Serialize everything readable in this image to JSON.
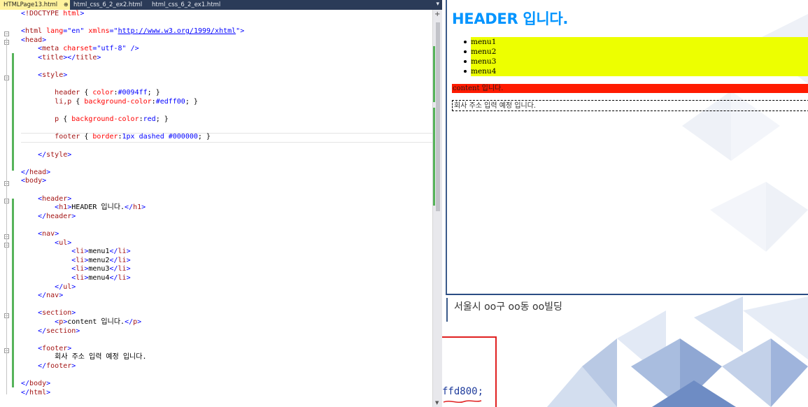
{
  "editor": {
    "tabs": [
      {
        "label": "HTMLPage13.html",
        "active": true,
        "pin": "pin-icon",
        "close": "close-icon"
      },
      {
        "label": "html_css_6_2_ex2.html",
        "active": false
      },
      {
        "label": "html_css_6_2_ex1.html",
        "active": false
      }
    ],
    "tab_menu_glyph": "▾",
    "code_lines": [
      "<!DOCTYPE html>",
      "",
      "<html lang=\"en\" xmlns=\"http://www.w3.org/1999/xhtml\">",
      "<head>",
      "    <meta charset=\"utf-8\" />",
      "    <title></title>",
      "",
      "    <style>",
      "",
      "        header { color:#0094ff; }",
      "        li,p { background-color:#edff00; }",
      "",
      "        p { background-color:red; }",
      "",
      "        footer { border:1px dashed #000000; }",
      "",
      "    </style>",
      "",
      "</head>",
      "<body>",
      "",
      "    <header>",
      "        <h1>HEADER 입니다.</h1>",
      "    </header>",
      "",
      "    <nav>",
      "        <ul>",
      "            <li>menu1</li>",
      "            <li>menu2</li>",
      "            <li>menu3</li>",
      "            <li>menu4</li>",
      "        </ul>",
      "    </nav>",
      "",
      "    <section>",
      "        <p>content 입니다.</p>",
      "    </section>",
      "",
      "    <footer>",
      "        회사 주소 입력 예정 입니다.",
      "    </footer>",
      "",
      "</body>",
      "</html>"
    ]
  },
  "preview": {
    "header_text": "HEADER 입니다.",
    "menu_items": [
      "menu1",
      "menu2",
      "menu3",
      "menu4"
    ],
    "content_text": "content 입니다.",
    "footer_text": "회사 주소 입력 예정 입니다.",
    "colors": {
      "header": "#0094ff",
      "nav": "#edff00",
      "content": "#ff1a00"
    }
  },
  "background": {
    "address_text": "서울시 oo구 oo동 oo빌딩",
    "code_fragment": "ffd800;"
  }
}
